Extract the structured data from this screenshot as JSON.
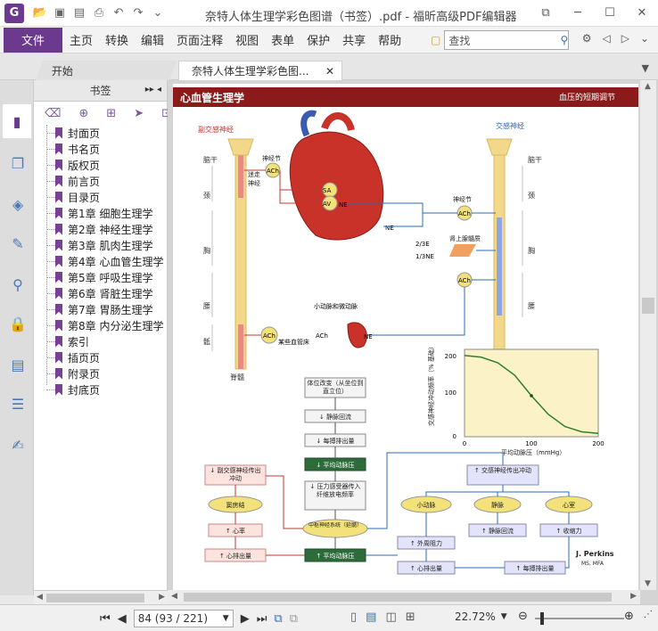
{
  "app": {
    "icon_letter": "G",
    "title": "奈特人体生理学彩色图谱（书签）.pdf - 福昕高级PDF编辑器"
  },
  "quick_access": [
    "folder-open-icon",
    "save-icon",
    "save-as-icon",
    "print-icon",
    "undo-icon",
    "redo-icon",
    "customize-icon"
  ],
  "window_buttons": [
    "restore-icon",
    "minimize-icon",
    "maximize-icon",
    "close-icon"
  ],
  "menu": {
    "file": "文件",
    "items": [
      "主页",
      "转换",
      "编辑",
      "页面",
      "注释",
      "视图",
      "表单",
      "保护",
      "共享",
      "帮助"
    ]
  },
  "search": {
    "placeholder": "查找"
  },
  "tabs": [
    {
      "label": "开始"
    },
    {
      "label": "奈特人体生理学彩色图..."
    }
  ],
  "bookmark_panel": {
    "title": "书签",
    "items": [
      "封面页",
      "书名页",
      "版权页",
      "前言页",
      "目录页",
      "第1章 细胞生理学",
      "第2章 神经生理学",
      "第3章 肌肉生理学",
      "第4章 心血管生理学",
      "第5章 呼吸生理学",
      "第6章 肾脏生理学",
      "第7章 胃肠生理学",
      "第8章 内分泌生理学",
      "索引",
      "插页页",
      "附录页",
      "封底页"
    ]
  },
  "page": {
    "header_title": "心血管生理学",
    "header_right": "血压的短期调节",
    "left_label_top": "副交感神经",
    "right_label_top": "交感神经",
    "side_labels_left": [
      "脑干",
      "颈",
      "胸",
      "腰",
      "骶",
      "脊髓"
    ],
    "side_labels_right": [
      "脑干",
      "颈",
      "胸",
      "腰"
    ],
    "ganglion_labels": [
      "神经节",
      "迷走",
      "神经",
      "神经节",
      "肾上腺髓质"
    ],
    "ach": "ACh",
    "ne": "NE",
    "sa": "SA",
    "av": "AV",
    "fractions": [
      "2/3E",
      "1/3NE"
    ],
    "vessel_label": "小动脉和微动脉",
    "vessel_sub": "某些血管床",
    "chart": {
      "ylabel": "交感神经冲动频率（% 基础）",
      "xlabel": "平均动脉压（mmHg）",
      "yticks": [
        "200",
        "100",
        "0"
      ],
      "xticks": [
        "0",
        "100",
        "200"
      ]
    },
    "flow": {
      "b1": "体位改变（从坐位到直立位）",
      "b2": "↓ 静脉回流",
      "b3": "↓ 每搏排出量",
      "b4": "↓ 平均动脉压",
      "b5": "↓ 压力感受器传入纤维放电频率",
      "b6": "中枢神经系统（延髓）",
      "b7": "↑ 平均动脉压",
      "l1": "↓ 副交感神经传出冲动",
      "l2": "窦房结",
      "l3": "↑ 心率",
      "l4": "↑ 心排出量",
      "r1": "↑ 交感神经传出冲动",
      "r2": "小动脉",
      "r3": "静脉",
      "r4": "心室",
      "r5": "↑ 外周阻力",
      "r6": "↑ 静脉回流",
      "r7": "↑ 收缩力",
      "r8": "↑ 心排出量",
      "r9": "↑ 每搏排出量"
    },
    "credit": "J. Perkins",
    "credit_sub": "MS, MFA"
  },
  "status": {
    "page_display": "84 (93 / 221)",
    "zoom": "22.72%"
  },
  "colors": {
    "accent": "#6b3a8e",
    "header_bar": "#8b1a1a"
  },
  "chart_data": {
    "type": "line",
    "title": "",
    "xlabel": "平均动脉压（mmHg）",
    "ylabel": "交感神经冲动频率（% 基础）",
    "xlim": [
      0,
      200
    ],
    "ylim": [
      0,
      200
    ],
    "series": [
      {
        "x": [
          0,
          25,
          50,
          75,
          100,
          125,
          150,
          175,
          200
        ],
        "y": [
          198,
          194,
          180,
          150,
          100,
          55,
          25,
          12,
          8
        ]
      }
    ]
  }
}
